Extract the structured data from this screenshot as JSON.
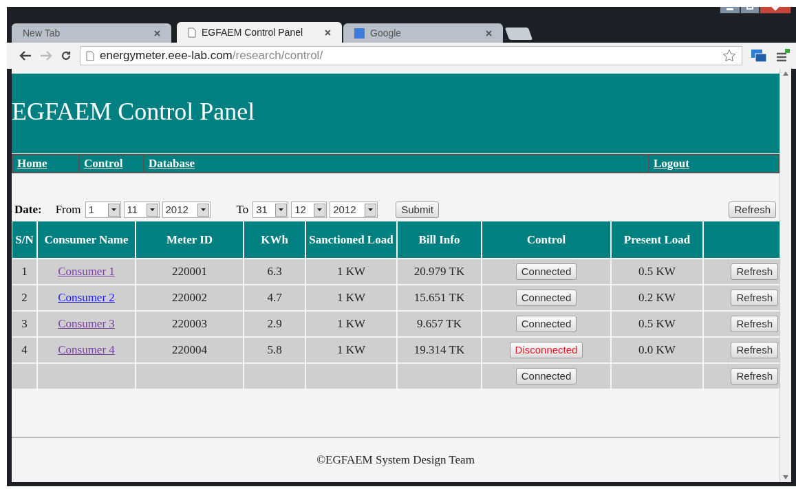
{
  "browser": {
    "tabs": [
      {
        "label": "New Tab",
        "selected": false,
        "kind": "blank"
      },
      {
        "label": "EGFAEM Control Panel",
        "selected": true,
        "kind": "page"
      },
      {
        "label": "Google",
        "selected": false,
        "kind": "google"
      }
    ],
    "address": {
      "host": "energymeter.eee-lab.com",
      "path": "/research/control/"
    }
  },
  "page": {
    "title": "EGFAEM Control Panel",
    "nav": [
      "Home",
      "Control",
      "Database"
    ],
    "nav_right": [
      "Logout"
    ],
    "date_filter": {
      "label": "Date:",
      "from_label": "From",
      "from": [
        "1",
        "11",
        "2012"
      ],
      "to_label": "To",
      "to": [
        "31",
        "12",
        "2012"
      ],
      "submit": "Submit",
      "refresh": "Refresh"
    },
    "table": {
      "columns": [
        "S/N",
        "Consumer Name",
        "Meter ID",
        "KWh",
        "Sanctioned Load",
        "Bill Info",
        "Control",
        "Present Load"
      ],
      "rows": [
        {
          "sn": "1",
          "name": "Consumer 1",
          "visited": true,
          "meter_id": "220001",
          "kwh": "6.3",
          "sanctioned": "1 KW",
          "bill": "20.979 TK",
          "control": "Connected",
          "connected": true,
          "load": "0.5 KW",
          "refresh": "Refresh"
        },
        {
          "sn": "2",
          "name": "Consumer 2",
          "visited": false,
          "meter_id": "220002",
          "kwh": "4.7",
          "sanctioned": "1 KW",
          "bill": "15.651 TK",
          "control": "Connected",
          "connected": true,
          "load": "0.2 KW",
          "refresh": "Refresh"
        },
        {
          "sn": "3",
          "name": "Consumer 3",
          "visited": true,
          "meter_id": "220003",
          "kwh": "2.9",
          "sanctioned": "1 KW",
          "bill": "9.657 TK",
          "control": "Connected",
          "connected": true,
          "load": "0.5 KW",
          "refresh": "Refresh"
        },
        {
          "sn": "4",
          "name": "Consumer 4",
          "visited": true,
          "meter_id": "220004",
          "kwh": "5.8",
          "sanctioned": "1 KW",
          "bill": "19.314 TK",
          "control": "Disconnected",
          "connected": false,
          "load": "0.0 KW",
          "refresh": "Refresh"
        },
        {
          "control": "Connected",
          "connected": true,
          "refresh": "Refresh"
        }
      ]
    },
    "footer": "©EGFAEM System Design Team"
  }
}
